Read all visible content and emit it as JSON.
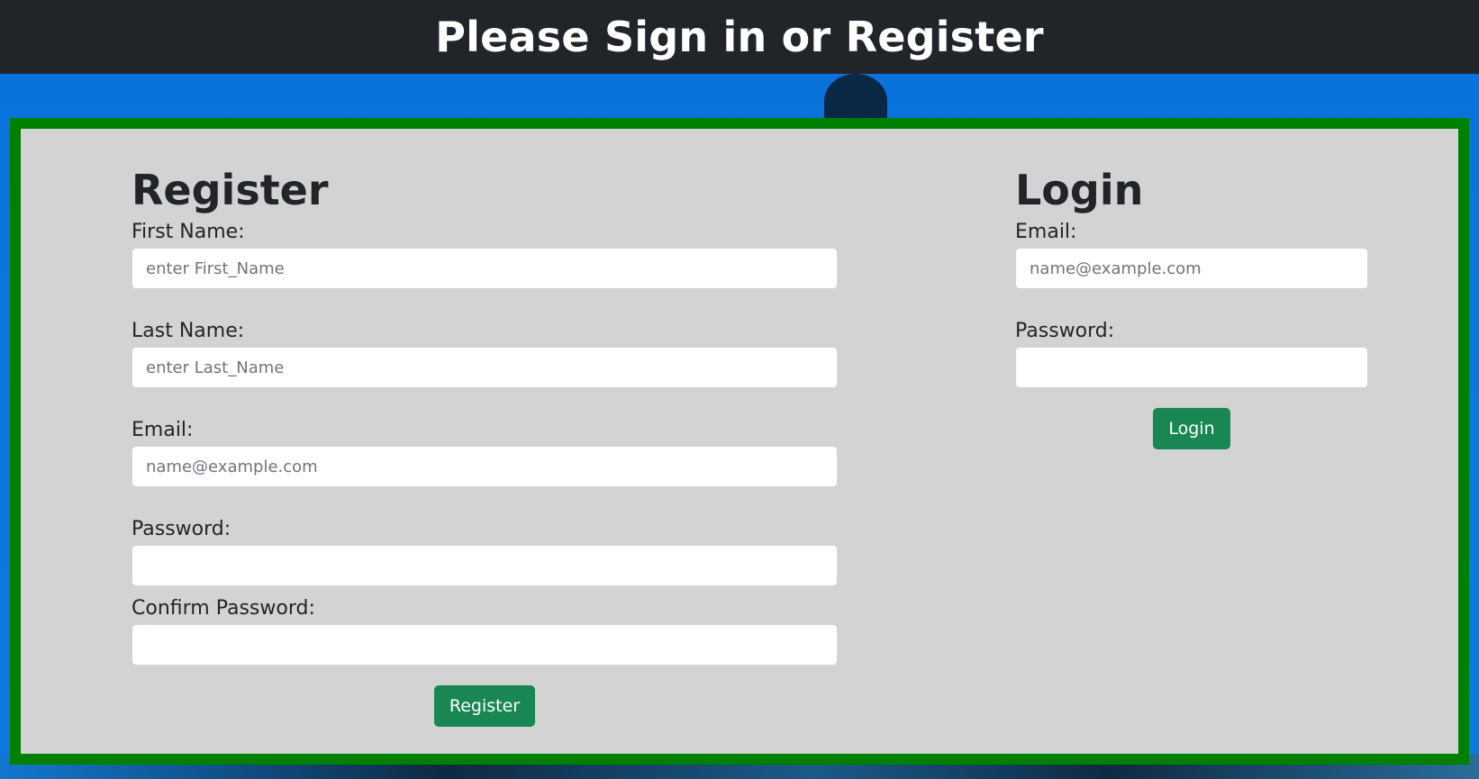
{
  "header": {
    "title": "Please Sign in or Register"
  },
  "register": {
    "heading": "Register",
    "first_name_label": "First Name:",
    "first_name_placeholder": "enter First_Name",
    "last_name_label": "Last Name:",
    "last_name_placeholder": "enter Last_Name",
    "email_label": "Email:",
    "email_placeholder": "name@example.com",
    "password_label": "Password:",
    "password_value": "",
    "confirm_password_label": "Confirm Password:",
    "confirm_password_value": "",
    "submit_label": "Register"
  },
  "login": {
    "heading": "Login",
    "email_label": "Email:",
    "email_placeholder": "name@example.com",
    "password_label": "Password:",
    "password_value": "",
    "submit_label": "Login"
  },
  "colors": {
    "header_bg": "#212529",
    "panel_bg": "#d3d3d3",
    "panel_border": "#008000",
    "button_bg": "#198754",
    "page_bg": "#0a72da"
  }
}
